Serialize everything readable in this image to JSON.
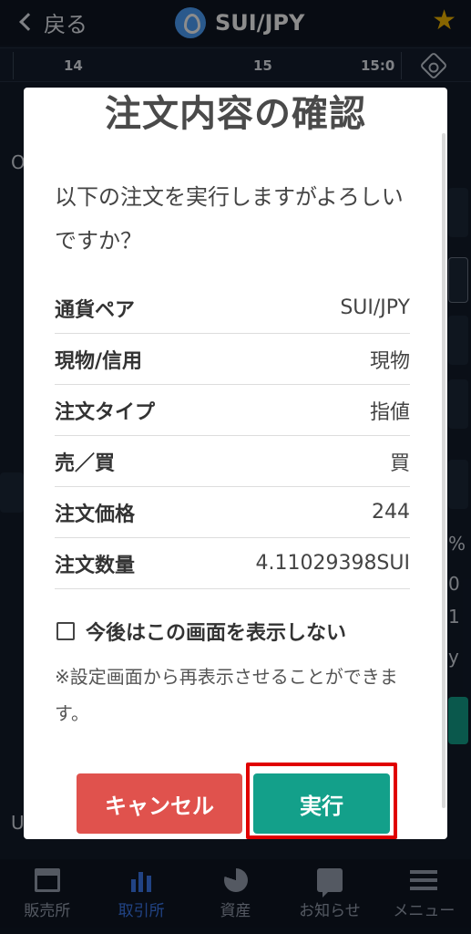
{
  "header": {
    "back_label": "戻る",
    "pair": "SUI/JPY"
  },
  "chart_axis": {
    "ticks": [
      "14",
      "15",
      "15:0"
    ]
  },
  "background": {
    "left_letters": [
      "O",
      "U"
    ],
    "right_fragments": [
      "%",
      "0",
      "1",
      "y"
    ]
  },
  "dialog": {
    "title": "注文内容の確認",
    "question": "以下の注文を実行しますがよろしいですか？",
    "rows": [
      {
        "label": "通貨ペア",
        "value": "SUI/JPY"
      },
      {
        "label": "現物/信用",
        "value": "現物"
      },
      {
        "label": "注文タイプ",
        "value": "指値"
      },
      {
        "label": "売／買",
        "value": "買"
      },
      {
        "label": "注文価格",
        "value": "244"
      },
      {
        "label": "注文数量",
        "value": "4.11029398SUI"
      }
    ],
    "dont_show_label": "今後はこの画面を表示しない",
    "note": "※設定画面から再表示させることができます。",
    "cancel_label": "キャンセル",
    "execute_label": "実行"
  },
  "bottom_nav": {
    "items": [
      {
        "label": "販売所",
        "icon": "shop-icon"
      },
      {
        "label": "取引所",
        "icon": "bar-chart-icon"
      },
      {
        "label": "資産",
        "icon": "pie-chart-icon"
      },
      {
        "label": "お知らせ",
        "icon": "chat-icon"
      },
      {
        "label": "メニュー",
        "icon": "menu-icon"
      }
    ],
    "active_index": 1
  },
  "colors": {
    "accent_green": "#13a08a",
    "cancel_red": "#e0524d",
    "highlight_red": "#e00000",
    "star_gold": "#f5b800",
    "nav_active_blue": "#3d7bf0"
  }
}
